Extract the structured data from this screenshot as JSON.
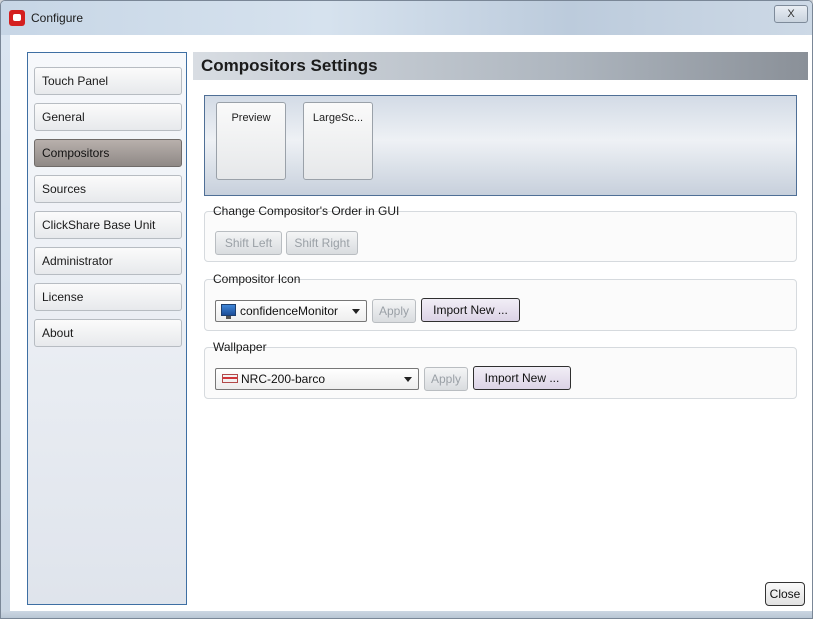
{
  "window": {
    "title": "Configure",
    "close_glyph": "X"
  },
  "sidebar": {
    "items": [
      {
        "label": "Touch Panel"
      },
      {
        "label": "General"
      },
      {
        "label": "Compositors",
        "active": true
      },
      {
        "label": "Sources"
      },
      {
        "label": "ClickShare Base Unit"
      },
      {
        "label": "Administrator"
      },
      {
        "label": "License"
      },
      {
        "label": "About"
      }
    ]
  },
  "main": {
    "title": "Compositors Settings",
    "compositors": [
      {
        "label": "Preview"
      },
      {
        "label": "LargeSc..."
      }
    ],
    "order_group": {
      "title": "Change Compositor's  Order in GUI",
      "shift_left": "Shift Left",
      "shift_right": "Shift Right"
    },
    "icon_group": {
      "title": "Compositor Icon",
      "selected": "confidenceMonitor",
      "icon": "monitor-icon",
      "apply": "Apply",
      "import": "Import New ..."
    },
    "wallpaper_group": {
      "title": "Wallpaper",
      "selected": "NRC-200-barco",
      "icon": "wallpaper-thumbnail-icon",
      "apply": "Apply",
      "import": "Import New ..."
    },
    "close": "Close"
  },
  "colors": {
    "active_nav": "#9d9693",
    "panel_border": "#3e6fa3",
    "app_icon": "#d41f1f"
  }
}
